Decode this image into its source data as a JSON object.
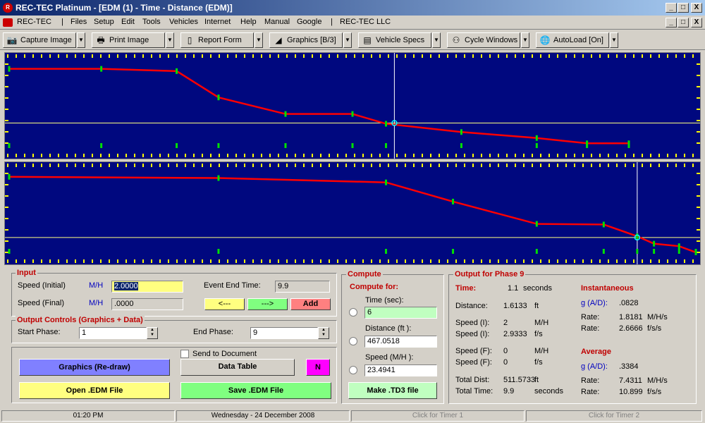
{
  "window": {
    "title": "REC-TEC Platinum - [EDM (1) - Time - Distance (EDM)]",
    "app_icon": "rec-tec-icon",
    "min_label": "_",
    "max_label": "□",
    "close_label": "X"
  },
  "menu": {
    "app_label": "REC-TEC",
    "separator": "|",
    "items": [
      "Files",
      "Setup",
      "Edit",
      "Tools",
      "Vehicles",
      "Internet",
      "Help",
      "Manual",
      "Google"
    ],
    "company": "REC-TEC LLC"
  },
  "toolbar": {
    "buttons": [
      {
        "label": "Capture Image",
        "icon": "camera-icon"
      },
      {
        "label": "Print Image",
        "icon": "printer-icon"
      },
      {
        "label": "Report Form",
        "icon": "report-icon"
      },
      {
        "label": "Graphics [B/3]",
        "icon": "graphics-icon"
      },
      {
        "label": "Vehicle Specs",
        "icon": "specs-icon"
      },
      {
        "label": "Cycle Windows",
        "icon": "binoculars-icon"
      },
      {
        "label": "AutoLoad [On]",
        "icon": "globe-icon"
      }
    ],
    "dropdown_glyph": "▼"
  },
  "chart_data": [
    {
      "type": "line",
      "name": "",
      "x": [
        0,
        1.1,
        2.0,
        2.5,
        3.3,
        4.1,
        4.5,
        5.4,
        6.3,
        6.9,
        7.4
      ],
      "y": [
        100,
        100,
        97,
        62,
        40,
        40,
        27,
        16,
        8,
        1,
        1
      ],
      "xlim": [
        0,
        8.2
      ],
      "ylim": [
        -10,
        110
      ],
      "cursor_x": 4.6,
      "cursor_y": 28,
      "line_color": "#ff0000",
      "background": "#00087f"
    },
    {
      "type": "line",
      "name": "",
      "x": [
        0,
        2.5,
        4.5,
        5.3,
        6.3,
        7.1,
        7.5,
        7.7,
        8.0,
        8.2
      ],
      "y": [
        100,
        98,
        91,
        60,
        24,
        23,
        4,
        -8,
        -12,
        -22
      ],
      "xlim": [
        0,
        8.2
      ],
      "ylim": [
        -30,
        110
      ],
      "cursor_x": 7.5,
      "cursor_y": 2,
      "line_color": "#ff0000",
      "background": "#00087f"
    }
  ],
  "input": {
    "title": "Input",
    "speed_initial_label": "Speed (Initial)",
    "speed_initial_unit": "M/H",
    "speed_initial_value": "2.0000",
    "speed_final_label": "Speed (Final)",
    "speed_final_unit": "M/H",
    "speed_final_value": ".0000",
    "event_end_label": "Event End Time:",
    "event_end_value": "9.9",
    "prev_label": "<---",
    "next_label": "--->",
    "add_label": "Add"
  },
  "output_controls": {
    "title": "Output Controls (Graphics + Data)",
    "start_phase_label": "Start Phase:",
    "start_phase_value": "1",
    "end_phase_label": "End Phase:",
    "end_phase_value": "9"
  },
  "actions": {
    "send_to_document_label": "Send to Document",
    "graphics_redraw": "Graphics (Re-draw)",
    "data_table": "Data Table",
    "n_label": "N",
    "open_edm": "Open .EDM File",
    "save_edm": "Save .EDM File"
  },
  "compute": {
    "title": "Compute",
    "compute_for_label": "Compute for:",
    "time_label": "Time (sec):",
    "time_value": "6",
    "distance_label": "Distance (ft ):",
    "distance_value": "467.0518",
    "speed_label": "Speed (M/H ):",
    "speed_value": "23.4941",
    "make_td3": "Make .TD3 file"
  },
  "output_phase": {
    "title": "Output for Phase 9",
    "time_label": "Time:",
    "time_value": "1.1",
    "time_unit": "seconds",
    "rows": [
      {
        "label": "Distance:",
        "value": "1.6133",
        "unit": "ft"
      },
      {
        "label": "Speed (I):",
        "value": "2",
        "unit": "M/H"
      },
      {
        "label": "Speed (I):",
        "value": "2.9333",
        "unit": "f/s"
      },
      {
        "label": "Speed (F):",
        "value": "0",
        "unit": "M/H"
      },
      {
        "label": "Speed (F):",
        "value": "0",
        "unit": "f/s"
      },
      {
        "label": "Total Dist:",
        "value": "511.5733",
        "unit": "ft"
      },
      {
        "label": "Total Time:",
        "value": "9.9",
        "unit": "seconds"
      }
    ],
    "instantaneous_title": "Instantaneous",
    "inst_g_label": "g (A/D):",
    "inst_g_value": ".0828",
    "inst_rate1_label": "Rate:",
    "inst_rate1_value": "1.8181",
    "inst_rate1_unit": "M/H/s",
    "inst_rate2_label": "Rate:",
    "inst_rate2_value": "2.6666",
    "inst_rate2_unit": "f/s/s",
    "average_title": "Average",
    "avg_g_label": "g (A/D):",
    "avg_g_value": ".3384",
    "avg_rate1_label": "Rate:",
    "avg_rate1_value": "7.4311",
    "avg_rate1_unit": "M/H/s",
    "avg_rate2_label": "Rate:",
    "avg_rate2_value": "10.899",
    "avg_rate2_unit": "f/s/s"
  },
  "status": {
    "time": "01:20 PM",
    "date": "Wednesday  -  24 December 2008",
    "timer1": "Click for Timer 1",
    "timer2": "Click for Timer 2"
  },
  "colors": {
    "chart_bg": "#00087f",
    "series": "#ff0000",
    "ticks": "#ffff00",
    "markers": "#00e000",
    "title_red": "#c00000"
  }
}
